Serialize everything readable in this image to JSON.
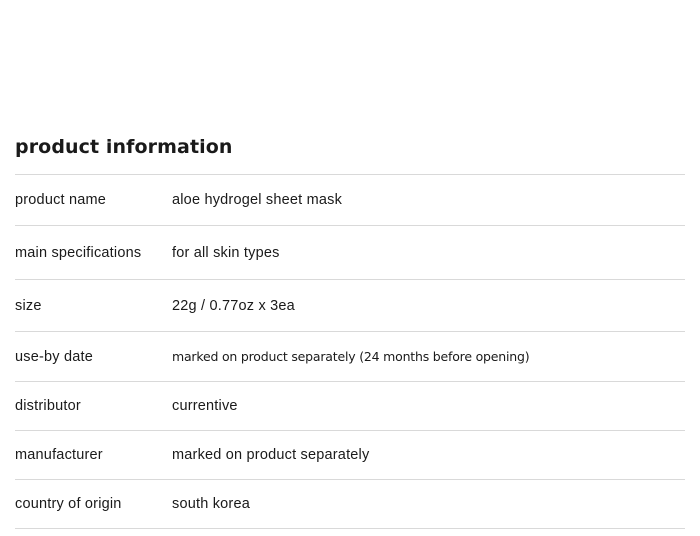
{
  "section": {
    "title": "product information"
  },
  "rows": [
    {
      "label": "product name",
      "value": "aloe hydrogel sheet mask"
    },
    {
      "label": "main specifications",
      "value": "for all skin types"
    },
    {
      "label": "size",
      "value": "22g / 0.77oz x 3ea"
    },
    {
      "label": "use-by date",
      "value": "marked on product separately (24 months before opening)"
    },
    {
      "label": "distributor",
      "value": "currentive"
    },
    {
      "label": "manufacturer",
      "value": "marked on product separately"
    },
    {
      "label": "country of origin",
      "value": "south korea"
    }
  ]
}
